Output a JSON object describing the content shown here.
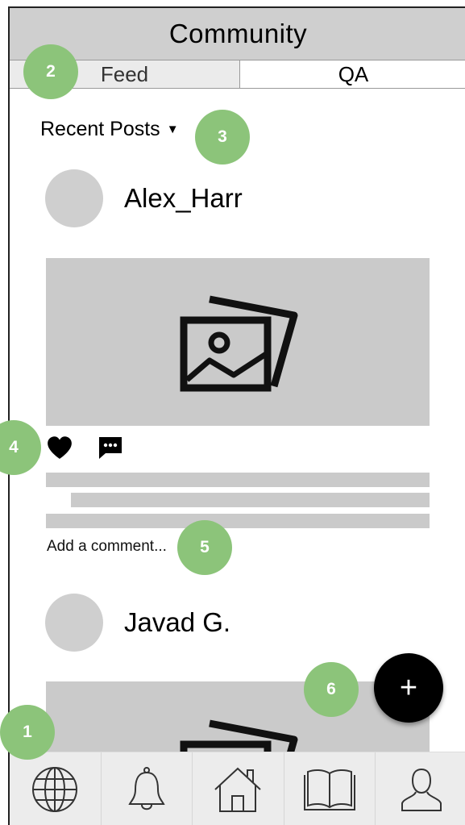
{
  "header": {
    "title": "Community"
  },
  "tabs": [
    {
      "label": "Feed",
      "active": true
    },
    {
      "label": "QA",
      "active": false
    }
  ],
  "sort": {
    "label": "Recent Posts",
    "caret": "▼"
  },
  "posts": [
    {
      "username": "Alex_Harr",
      "image_icon": "photos-icon",
      "liked": true
    },
    {
      "username": "Javad G.",
      "image_icon": "photos-icon"
    }
  ],
  "comment": {
    "placeholder": "Add a comment..."
  },
  "fab": {
    "label": "+"
  },
  "bottom_nav": [
    {
      "icon": "globe-icon"
    },
    {
      "icon": "bell-icon"
    },
    {
      "icon": "home-icon"
    },
    {
      "icon": "book-icon"
    },
    {
      "icon": "profile-icon"
    }
  ],
  "annotations": [
    "1",
    "2",
    "3",
    "4",
    "5",
    "6"
  ],
  "colors": {
    "header_bg": "#cfcfcf",
    "placeholder_gray": "#cacaca",
    "marker_green": "#8cc47a",
    "fab": "#000000"
  }
}
